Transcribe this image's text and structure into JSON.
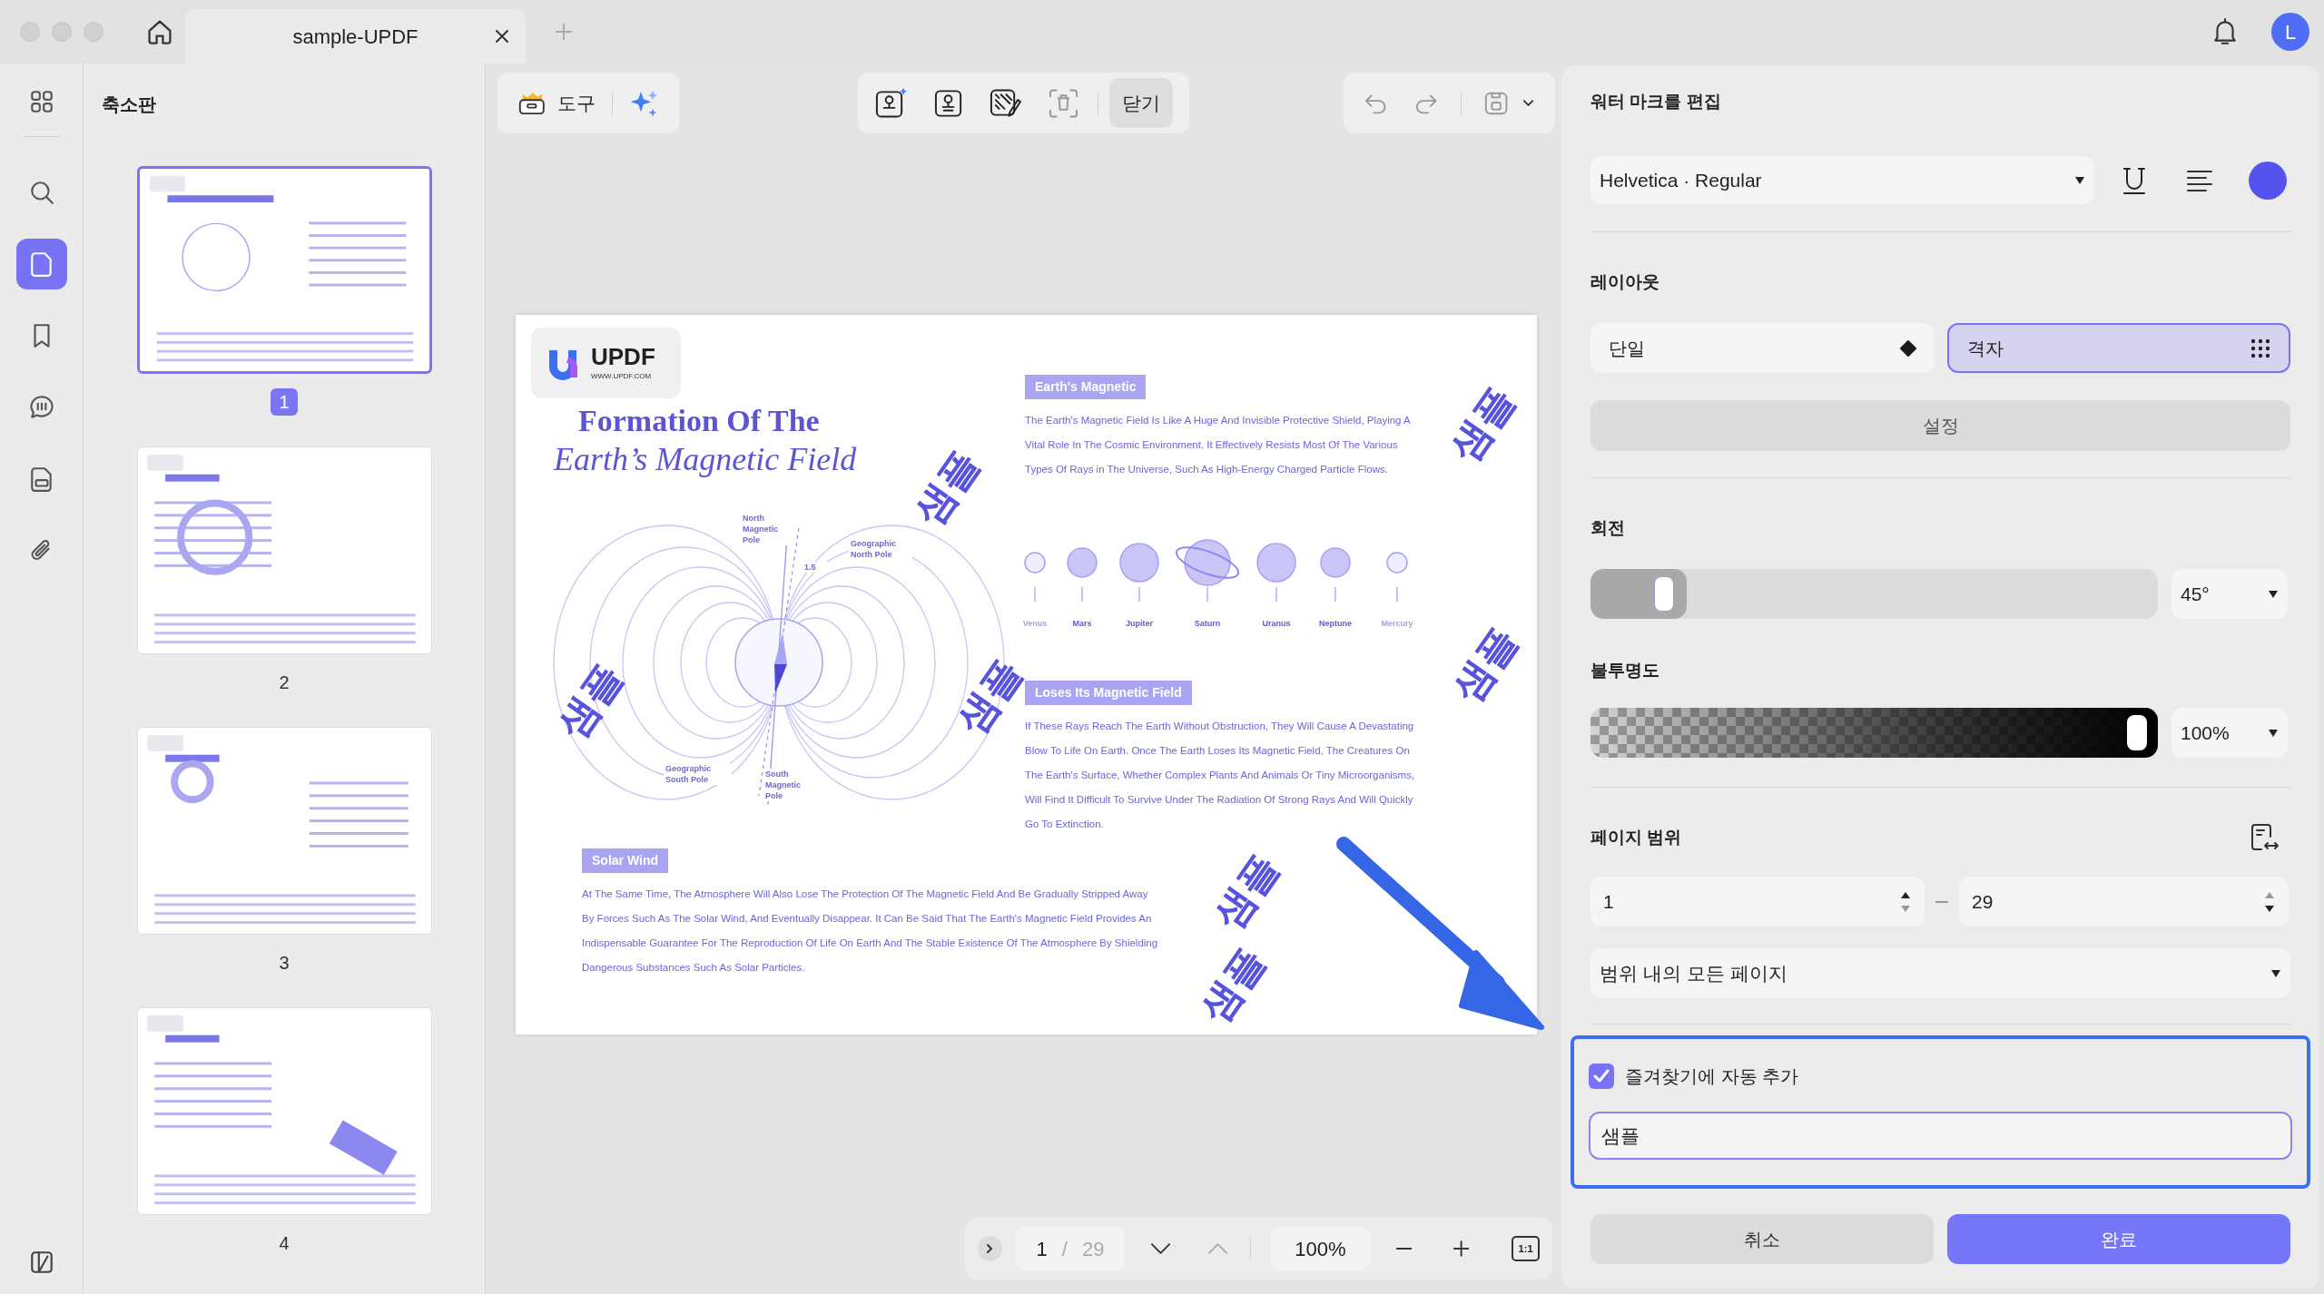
{
  "window": {
    "tab_title": "sample-UPDF",
    "avatar": "L"
  },
  "sidebar": {
    "items": [
      {
        "kind": "grid",
        "selected": false
      },
      {
        "kind": "search",
        "selected": false
      },
      {
        "kind": "page",
        "selected": true
      },
      {
        "kind": "bookmark",
        "selected": false
      },
      {
        "kind": "comment",
        "selected": false
      },
      {
        "kind": "form",
        "selected": false
      },
      {
        "kind": "attachment",
        "selected": false
      }
    ]
  },
  "thumbnails": {
    "title": "축소판",
    "pages": [
      {
        "label": "1",
        "selected": true
      },
      {
        "label": "2",
        "selected": false
      },
      {
        "label": "3",
        "selected": false
      },
      {
        "label": "4",
        "selected": false
      }
    ]
  },
  "toolbar": {
    "tools": "도구",
    "close": "닫기"
  },
  "document": {
    "logo": "UPDF",
    "logo_url": "WWW.UPDF.COM",
    "title": "Formation Of The",
    "subtitle": "Earth’s Magnetic Field",
    "sections": [
      {
        "heading": "Earth's Magnetic",
        "text": "The Earth's Magnetic Field Is Like A Huge And Invisible Protective Shield, Playing A Vital Role In The Cosmic Environment. It Effectively Resists Most Of The Various Types Of Rays in The Universe, Such As High-Energy Charged Particle Flows."
      },
      {
        "heading": "Loses Its Magnetic Field",
        "text": "If These Rays Reach The Earth Without Obstruction, They Will Cause A Devastating Blow To Life On Earth. Once The Earth Loses Its Magnetic Field, The Creatures On The Earth's Surface, Whether Complex Plants And Animals Or Tiny Microorganisms, Will Find It Difficult To Survive Under The Radiation Of Strong Rays And Will Quickly Go To Extinction."
      },
      {
        "heading": "Solar Wind",
        "text": "At The Same Time, The Atmosphere Will Also Lose The Protection Of The Magnetic Field And Be Gradually Stripped Away By Forces Such As The Solar Wind, And Eventually Disappear. It Can Be Said That The Earth's Magnetic Field Provides An Indispensable Guarantee For The Reproduction Of Life On Earth And The Stable Existence Of The Atmosphere By Shielding Dangerous Substances Such As Solar Particles."
      }
    ],
    "diagram_labels": [
      "North Magnetic Pole",
      "Geographic North Pole",
      "1.5",
      "Geographic South Pole",
      "South Magnetic Pole"
    ],
    "planets": [
      {
        "name": "Venus",
        "faded": true
      },
      {
        "name": "Mars",
        "faded": false
      },
      {
        "name": "Jupiter",
        "faded": false
      },
      {
        "name": "Saturn",
        "faded": false
      },
      {
        "name": "Uranus",
        "faded": false
      },
      {
        "name": "Neptune",
        "faded": false
      },
      {
        "name": "Mercury",
        "faded": true
      }
    ],
    "watermarks": [
      "샘플",
      "샘플",
      "샘플",
      "샘플",
      "샘플",
      "샘플",
      "샘플"
    ]
  },
  "page_nav": {
    "current": "1",
    "separator": "/",
    "total": "29",
    "zoom": "100%",
    "actual_size": "1:1"
  },
  "watermark_panel": {
    "title": "워터 마크를 편집",
    "font": "Helvetica · Regular",
    "layout": {
      "heading": "레이아웃",
      "options": [
        {
          "label": "단일",
          "kind": "single",
          "selected": false
        },
        {
          "label": "격자",
          "kind": "grid",
          "selected": true
        }
      ],
      "settings": "설정"
    },
    "rotation": {
      "heading": "회전",
      "level": 0.17,
      "value": "45°"
    },
    "opacity": {
      "heading": "불투명도",
      "level": 1,
      "value": "100%"
    },
    "page_range": {
      "heading": "페이지 범위",
      "from": "1",
      "to": "29",
      "subset": "범위 내의 모든 페이지"
    },
    "favorite": {
      "label": "즐겨찾기에 자동 추가",
      "checked": true,
      "value": "샘플"
    },
    "cancel": "취소",
    "done": "완료"
  }
}
